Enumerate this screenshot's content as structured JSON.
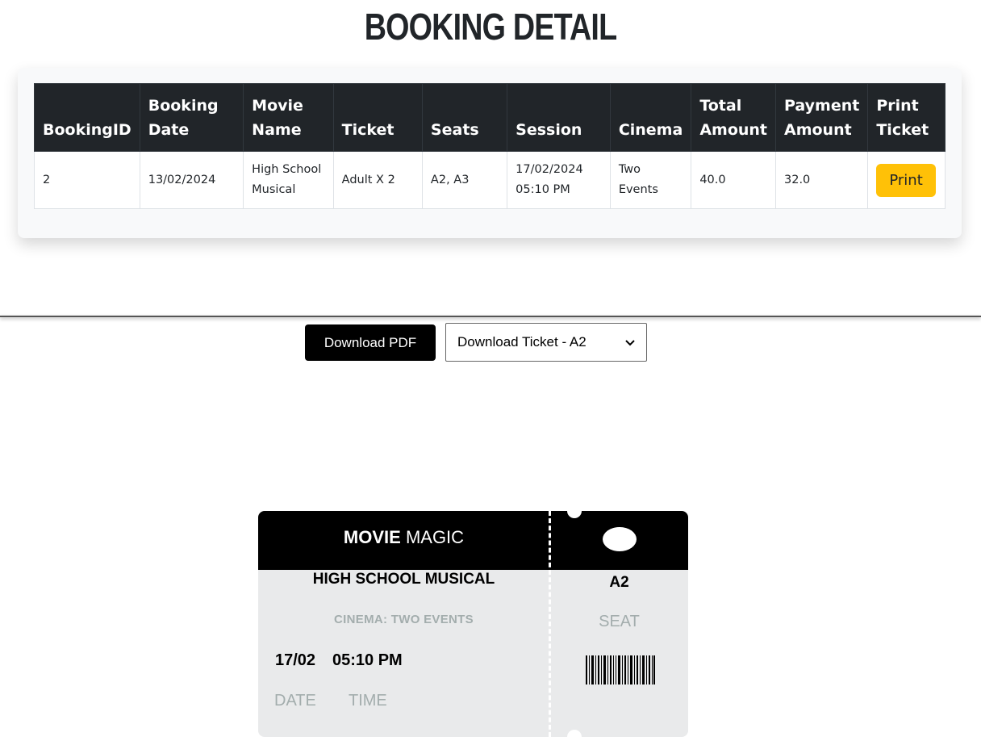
{
  "page": {
    "title": "BOOKING DETAIL"
  },
  "table": {
    "headers": [
      "BookingID",
      "Booking Date",
      "Movie Name",
      "Ticket",
      "Seats",
      "Session",
      "Cinema",
      "Total Amount",
      "Payment Amount",
      "Print Ticket"
    ],
    "rows": [
      {
        "booking_id": "2",
        "booking_date": "13/02/2024",
        "movie_name": "High School Musical",
        "ticket": "Adult X 2",
        "seats": "A2, A3",
        "session": "17/02/2024 05:10 PM",
        "cinema": "Two Events",
        "total_amount": "40.0",
        "payment_amount": "32.0",
        "print_label": "Print"
      }
    ]
  },
  "controls": {
    "download_pdf_label": "Download PDF",
    "ticket_select": {
      "selected": "Download Ticket - A2"
    }
  },
  "ticket": {
    "brand_bold": "MOVIE",
    "brand_rest": " MAGIC",
    "movie_title": "HIGH SCHOOL MUSICAL",
    "cinema_line": "CINEMA: TWO EVENTS",
    "date": "17/02",
    "time": "05:10 PM",
    "date_label": "DATE",
    "time_label": "TIME",
    "seat": "A2",
    "seat_label": "SEAT"
  },
  "colors": {
    "table_header_bg": "#212529",
    "print_button": "#ffc107",
    "ticket_body": "#e9eaeb",
    "ticket_header": "#000000",
    "muted_text": "#a3adad"
  },
  "icons": {
    "ticket_logo": "oval-logo-icon",
    "barcode": "barcode-icon",
    "select_arrow": "chevron-down-icon"
  }
}
